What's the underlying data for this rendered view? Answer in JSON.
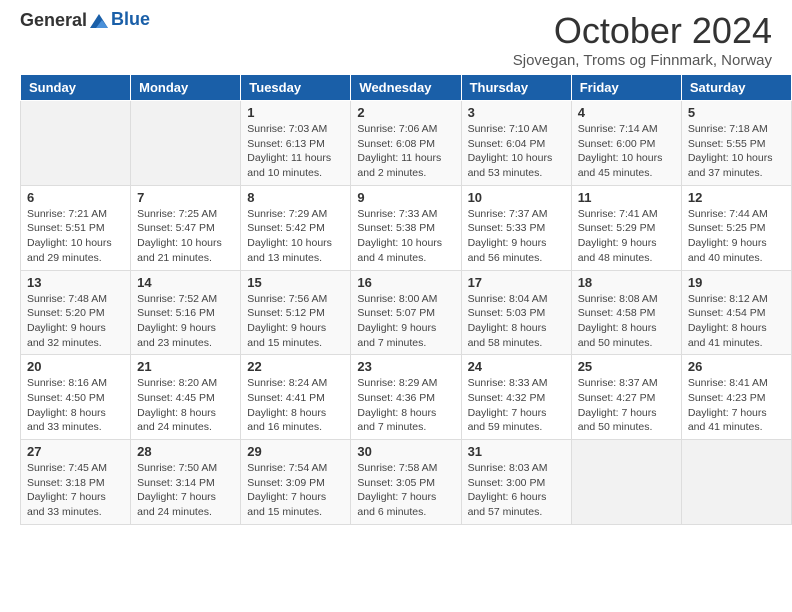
{
  "header": {
    "logo_general": "General",
    "logo_blue": "Blue",
    "month_title": "October 2024",
    "subtitle": "Sjovegan, Troms og Finnmark, Norway"
  },
  "days_of_week": [
    "Sunday",
    "Monday",
    "Tuesday",
    "Wednesday",
    "Thursday",
    "Friday",
    "Saturday"
  ],
  "weeks": [
    [
      {
        "day": "",
        "info": ""
      },
      {
        "day": "",
        "info": ""
      },
      {
        "day": "1",
        "info": "Sunrise: 7:03 AM\nSunset: 6:13 PM\nDaylight: 11 hours and 10 minutes."
      },
      {
        "day": "2",
        "info": "Sunrise: 7:06 AM\nSunset: 6:08 PM\nDaylight: 11 hours and 2 minutes."
      },
      {
        "day": "3",
        "info": "Sunrise: 7:10 AM\nSunset: 6:04 PM\nDaylight: 10 hours and 53 minutes."
      },
      {
        "day": "4",
        "info": "Sunrise: 7:14 AM\nSunset: 6:00 PM\nDaylight: 10 hours and 45 minutes."
      },
      {
        "day": "5",
        "info": "Sunrise: 7:18 AM\nSunset: 5:55 PM\nDaylight: 10 hours and 37 minutes."
      }
    ],
    [
      {
        "day": "6",
        "info": "Sunrise: 7:21 AM\nSunset: 5:51 PM\nDaylight: 10 hours and 29 minutes."
      },
      {
        "day": "7",
        "info": "Sunrise: 7:25 AM\nSunset: 5:47 PM\nDaylight: 10 hours and 21 minutes."
      },
      {
        "day": "8",
        "info": "Sunrise: 7:29 AM\nSunset: 5:42 PM\nDaylight: 10 hours and 13 minutes."
      },
      {
        "day": "9",
        "info": "Sunrise: 7:33 AM\nSunset: 5:38 PM\nDaylight: 10 hours and 4 minutes."
      },
      {
        "day": "10",
        "info": "Sunrise: 7:37 AM\nSunset: 5:33 PM\nDaylight: 9 hours and 56 minutes."
      },
      {
        "day": "11",
        "info": "Sunrise: 7:41 AM\nSunset: 5:29 PM\nDaylight: 9 hours and 48 minutes."
      },
      {
        "day": "12",
        "info": "Sunrise: 7:44 AM\nSunset: 5:25 PM\nDaylight: 9 hours and 40 minutes."
      }
    ],
    [
      {
        "day": "13",
        "info": "Sunrise: 7:48 AM\nSunset: 5:20 PM\nDaylight: 9 hours and 32 minutes."
      },
      {
        "day": "14",
        "info": "Sunrise: 7:52 AM\nSunset: 5:16 PM\nDaylight: 9 hours and 23 minutes."
      },
      {
        "day": "15",
        "info": "Sunrise: 7:56 AM\nSunset: 5:12 PM\nDaylight: 9 hours and 15 minutes."
      },
      {
        "day": "16",
        "info": "Sunrise: 8:00 AM\nSunset: 5:07 PM\nDaylight: 9 hours and 7 minutes."
      },
      {
        "day": "17",
        "info": "Sunrise: 8:04 AM\nSunset: 5:03 PM\nDaylight: 8 hours and 58 minutes."
      },
      {
        "day": "18",
        "info": "Sunrise: 8:08 AM\nSunset: 4:58 PM\nDaylight: 8 hours and 50 minutes."
      },
      {
        "day": "19",
        "info": "Sunrise: 8:12 AM\nSunset: 4:54 PM\nDaylight: 8 hours and 41 minutes."
      }
    ],
    [
      {
        "day": "20",
        "info": "Sunrise: 8:16 AM\nSunset: 4:50 PM\nDaylight: 8 hours and 33 minutes."
      },
      {
        "day": "21",
        "info": "Sunrise: 8:20 AM\nSunset: 4:45 PM\nDaylight: 8 hours and 24 minutes."
      },
      {
        "day": "22",
        "info": "Sunrise: 8:24 AM\nSunset: 4:41 PM\nDaylight: 8 hours and 16 minutes."
      },
      {
        "day": "23",
        "info": "Sunrise: 8:29 AM\nSunset: 4:36 PM\nDaylight: 8 hours and 7 minutes."
      },
      {
        "day": "24",
        "info": "Sunrise: 8:33 AM\nSunset: 4:32 PM\nDaylight: 7 hours and 59 minutes."
      },
      {
        "day": "25",
        "info": "Sunrise: 8:37 AM\nSunset: 4:27 PM\nDaylight: 7 hours and 50 minutes."
      },
      {
        "day": "26",
        "info": "Sunrise: 8:41 AM\nSunset: 4:23 PM\nDaylight: 7 hours and 41 minutes."
      }
    ],
    [
      {
        "day": "27",
        "info": "Sunrise: 7:45 AM\nSunset: 3:18 PM\nDaylight: 7 hours and 33 minutes."
      },
      {
        "day": "28",
        "info": "Sunrise: 7:50 AM\nSunset: 3:14 PM\nDaylight: 7 hours and 24 minutes."
      },
      {
        "day": "29",
        "info": "Sunrise: 7:54 AM\nSunset: 3:09 PM\nDaylight: 7 hours and 15 minutes."
      },
      {
        "day": "30",
        "info": "Sunrise: 7:58 AM\nSunset: 3:05 PM\nDaylight: 7 hours and 6 minutes."
      },
      {
        "day": "31",
        "info": "Sunrise: 8:03 AM\nSunset: 3:00 PM\nDaylight: 6 hours and 57 minutes."
      },
      {
        "day": "",
        "info": ""
      },
      {
        "day": "",
        "info": ""
      }
    ]
  ]
}
